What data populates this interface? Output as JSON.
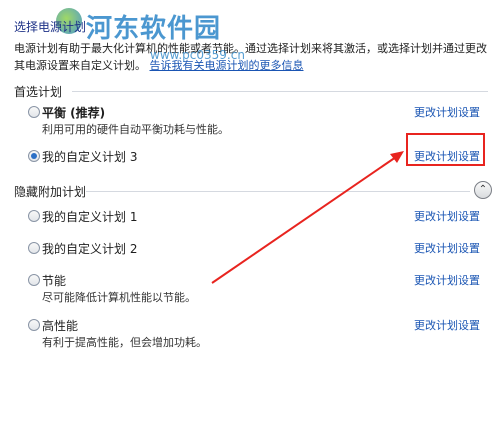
{
  "page": {
    "title": "选择电源计划",
    "description": "电源计划有助于最大化计算机的性能或者节能。通过选择计划来将其激活，或选择计划并通过更改其电源设置来自定义计划。",
    "description_link": "告诉我有关电源计划的更多信息"
  },
  "watermark": {
    "text": "河东软件园",
    "subtext": "www.pc0359.cn"
  },
  "preferred": {
    "header": "首选计划",
    "plans": [
      {
        "name": "平衡 (推荐)",
        "desc": "利用可用的硬件自动平衡功耗与性能。",
        "link": "更改计划设置",
        "checked": false,
        "bold": true
      },
      {
        "name": "我的自定义计划 3",
        "desc": "",
        "link": "更改计划设置",
        "checked": true,
        "bold": false
      }
    ]
  },
  "hidden": {
    "header": "隐藏附加计划",
    "collapse_glyph": "⌃",
    "plans": [
      {
        "name": "我的自定义计划 1",
        "desc": "",
        "link": "更改计划设置",
        "checked": false
      },
      {
        "name": "我的自定义计划 2",
        "desc": "",
        "link": "更改计划设置",
        "checked": false
      },
      {
        "name": "节能",
        "desc": "尽可能降低计算机性能以节能。",
        "link": "更改计划设置",
        "checked": false
      },
      {
        "name": "高性能",
        "desc": "有利于提高性能，但会增加功耗。",
        "link": "更改计划设置",
        "checked": false
      }
    ]
  },
  "annotation": {
    "color": "#e8241f"
  }
}
